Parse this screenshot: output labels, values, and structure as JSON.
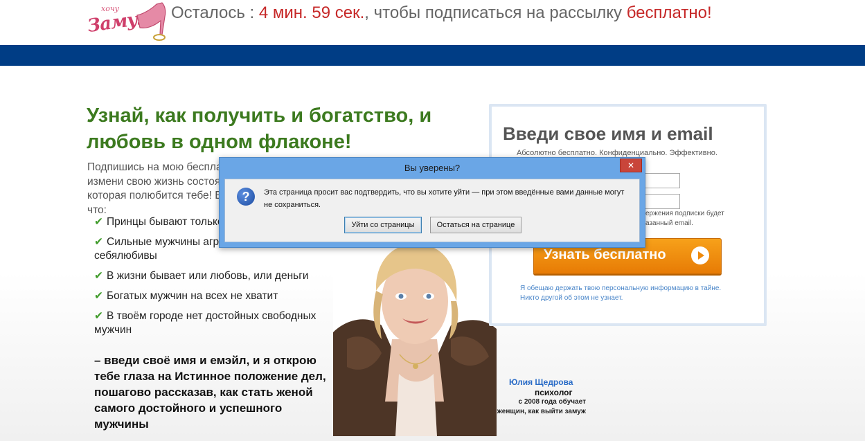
{
  "header": {
    "logo": {
      "small_text": "хочу",
      "main_text": "Замуж"
    },
    "timer": {
      "prefix": "Осталось : ",
      "time": "4 мин. 59 сек.",
      "middle": ", чтобы подписаться на рассылку ",
      "highlight": "бесплатно",
      "suffix": "!"
    }
  },
  "main": {
    "headline": "Узнай, как получить и богатство, и любовь в одном флаконе!",
    "intro": "Подпишись на мою бесплатную рассылку и измени свою жизнь состоятельной женщины, которая полюбится тебе! Если ты думаешь, что:",
    "checklist": [
      "Принцы бывают только в сказках",
      "Сильные мужчины агрессивны и себялюбивы",
      "В жизни бывает или любовь, или деньги",
      "Богатых мужчин на всех не хватит",
      "В твоём городе нет достойных свободных мужчин"
    ],
    "cta": "– введи своё имя и емэйл, и я открою тебе глаза на Истинное положение дел, пошагово рассказав, как стать женой самого достойного и успешного мужчины"
  },
  "author": {
    "name": "Юлия Щедрова",
    "role": "психолог",
    "desc": "с 2008 года обучает женщин, как выйти замуж"
  },
  "form": {
    "title": "Введи свое имя и email",
    "subtitle": "Абсолютно бесплатно. Конфиденциально. Эффективно.",
    "confirm_note_line1": "ержения подписки будет",
    "confirm_note_line2": "азанный email.",
    "submit_label": "Узнать бесплатно",
    "privacy": "Я обещаю держать твою персональную информацию в тайне. Никто другой об этом не узнает."
  },
  "dialog": {
    "title": "Вы уверены?",
    "close_label": "✕",
    "message": "Эта страница просит вас подтвердить, что вы хотите уйти — при этом введённые вами данные могут не сохраниться.",
    "leave_label": "Уйти со страницы",
    "stay_label": "Остаться на странице"
  },
  "colors": {
    "header_band": "#003d85",
    "headline_green": "#3c7a1f",
    "timer_red": "#c62828",
    "button_orange": "#f39415"
  }
}
